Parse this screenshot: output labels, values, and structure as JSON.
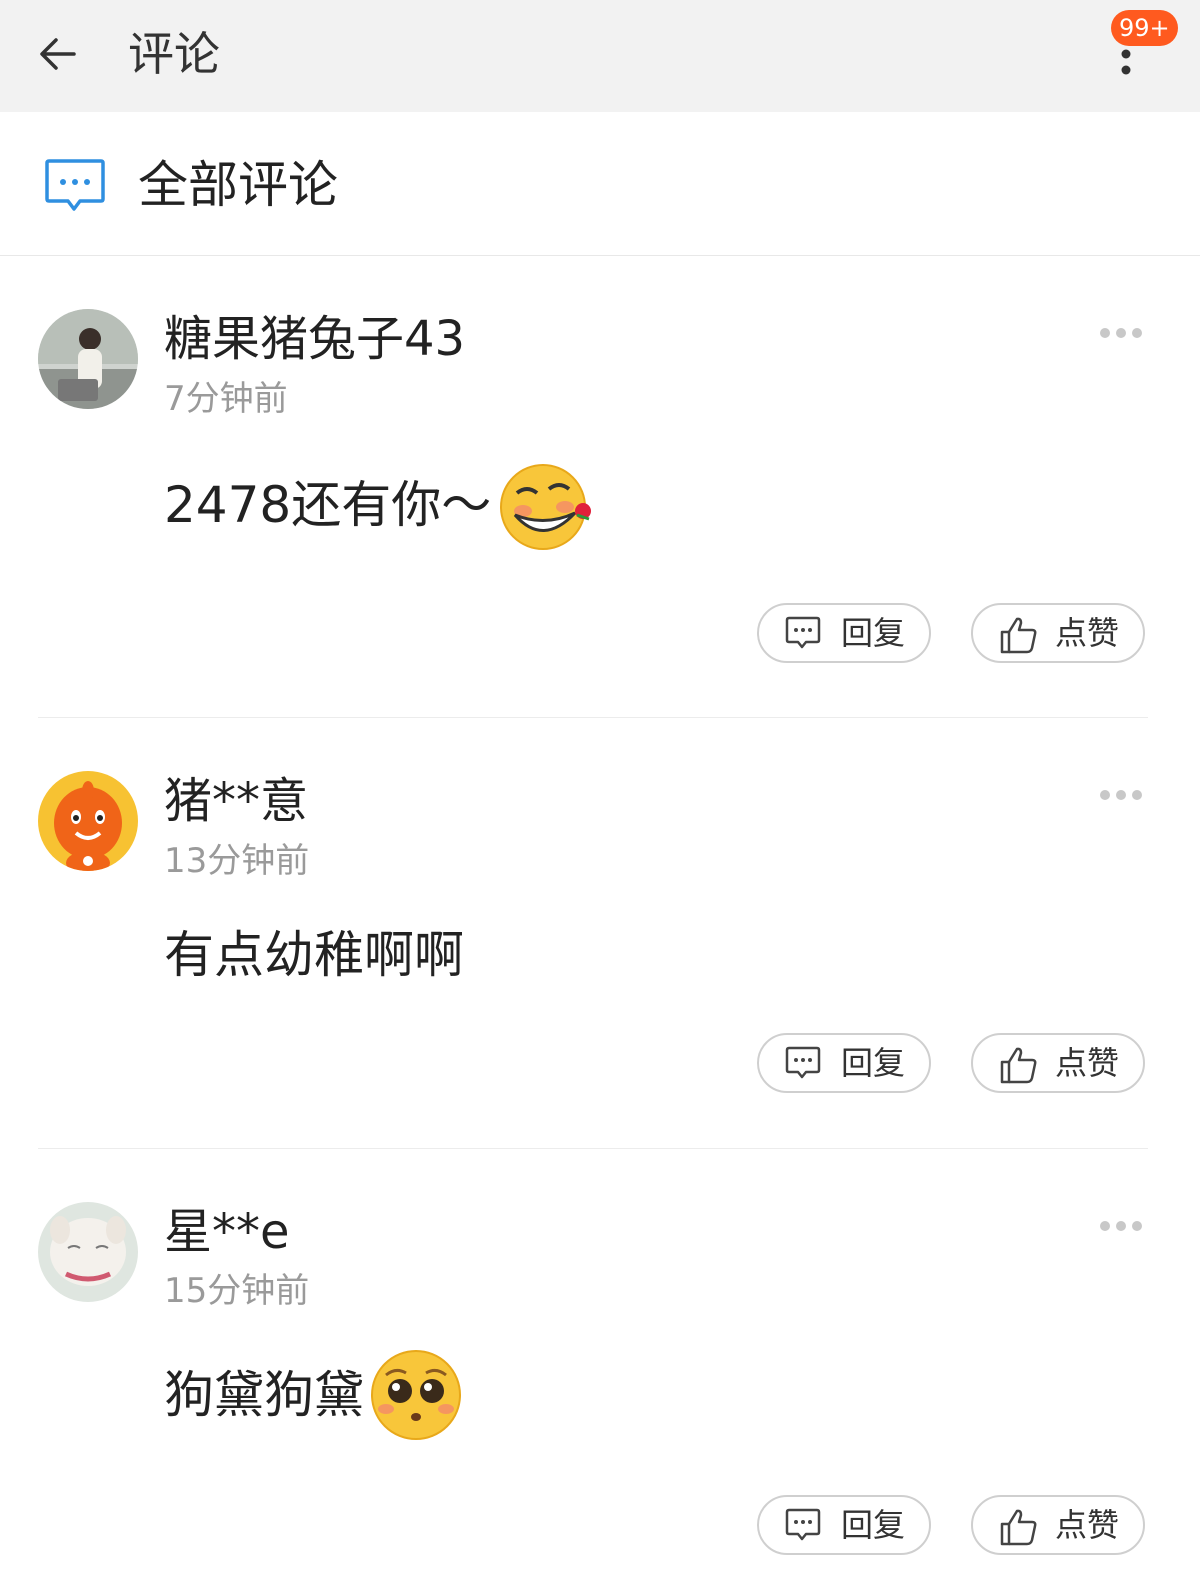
{
  "header": {
    "title": "评论",
    "badge": "99+"
  },
  "section": {
    "title": "全部评论"
  },
  "comments": [
    {
      "username": "糖果猪兔子43",
      "time": "7分钟前",
      "text": "2478还有你～",
      "emoji": "grin-rose-emoji",
      "reply_label": "回复",
      "like_label": "点赞"
    },
    {
      "username": "猪**意",
      "time": "13分钟前",
      "text": "有点幼稚啊啊",
      "emoji": "",
      "reply_label": "回复",
      "like_label": "点赞"
    },
    {
      "username": "星**e",
      "time": "15分钟前",
      "text": "狗黛狗黛",
      "emoji": "pleading-emoji",
      "reply_label": "回复",
      "like_label": "点赞"
    }
  ],
  "colors": {
    "accent": "#2f8fe0",
    "badge": "#ff5a1f",
    "muted": "#9a9a9a"
  }
}
